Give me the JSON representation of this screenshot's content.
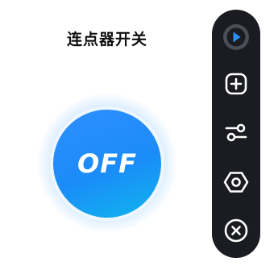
{
  "title": "连点器开关",
  "toggle": {
    "label": "OFF",
    "state": "off",
    "color_start": "#2f8fff",
    "color_end": "#10b6ee"
  },
  "toolbar": {
    "background": "#1a1c21",
    "items": [
      {
        "icon": "play-icon",
        "active": true
      },
      {
        "icon": "plus-icon"
      },
      {
        "icon": "sliders-icon"
      },
      {
        "icon": "settings-hexagon-icon"
      },
      {
        "icon": "close-icon"
      }
    ]
  }
}
